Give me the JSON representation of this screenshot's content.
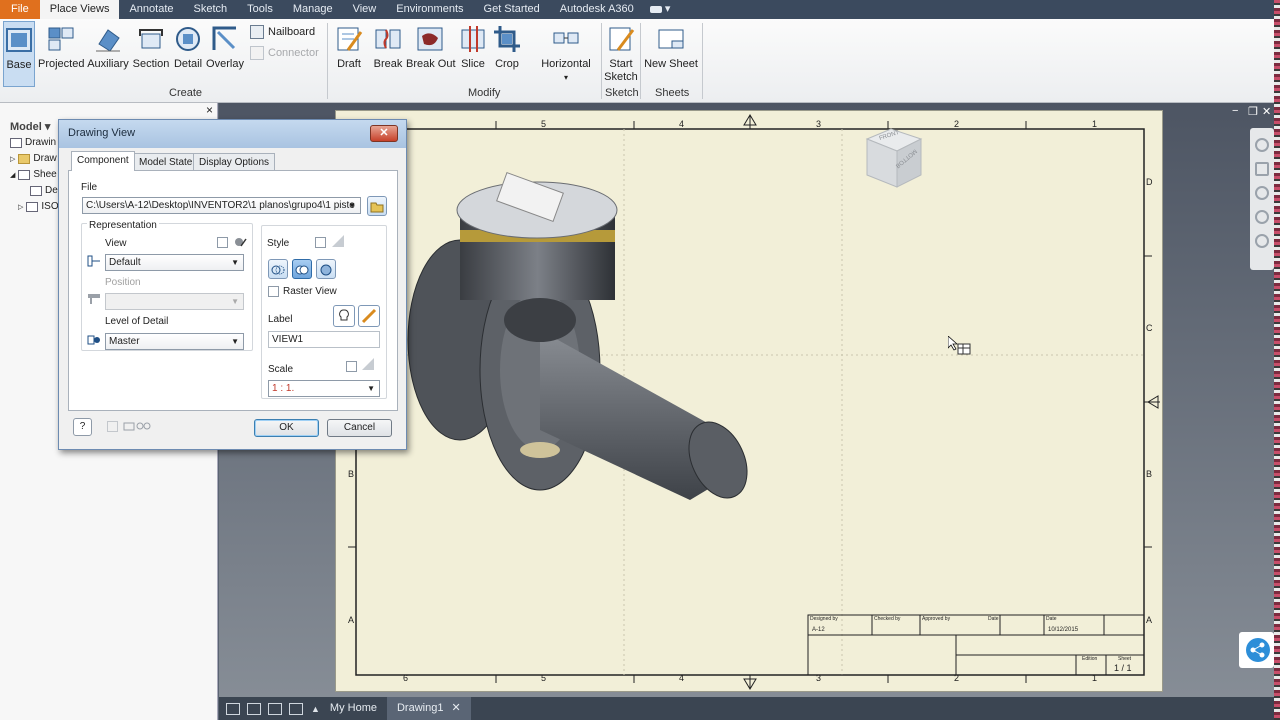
{
  "menu": {
    "items": [
      "File",
      "Place Views",
      "Annotate",
      "Sketch",
      "Tools",
      "Manage",
      "View",
      "Environments",
      "Get Started",
      "Autodesk A360"
    ],
    "active": "Place Views",
    "extra": "▾"
  },
  "ribbon": {
    "create": {
      "label": "Create",
      "buttons": [
        "Base",
        "Projected",
        "Auxiliary",
        "Section",
        "Detail",
        "Overlay"
      ],
      "small": [
        "Nailboard",
        "Connector"
      ]
    },
    "modify": {
      "label": "Modify",
      "buttons": [
        "Draft",
        "Break",
        "Break Out",
        "Slice",
        "Crop",
        "Horizontal"
      ]
    },
    "sketch": {
      "label": "Sketch",
      "button_line1": "Start",
      "button_line2": "Sketch"
    },
    "sheets": {
      "label": "Sheets",
      "button": "New Sheet"
    }
  },
  "browser": {
    "header": "Model ▾",
    "close": "×",
    "items": [
      "Drawin",
      "Draw",
      "Shee",
      "De",
      "ISO"
    ]
  },
  "dialog": {
    "title": "Drawing View",
    "close": "✕",
    "tabs": [
      "Component",
      "Model State",
      "Display Options"
    ],
    "file_label": "File",
    "file_value": "C:\\Users\\A-12\\Desktop\\INVENTOR2\\1 planos\\grupo4\\1 pisto",
    "representation_label": "Representation",
    "view_label": "View",
    "view_value": "Default",
    "position_label": "Position",
    "lod_label": "Level of Detail",
    "lod_value": "Master",
    "style_label": "Style",
    "raster_label": "Raster View",
    "label_label": "Label",
    "label_value": "VIEW1",
    "scale_label": "Scale",
    "scale_value": "1 : 1.",
    "help": "?",
    "ok": "OK",
    "cancel": "Cancel"
  },
  "sheet": {
    "col_numbers": [
      "5",
      "4",
      "3",
      "2",
      "1"
    ],
    "bottom_numbers": [
      "6",
      "5",
      "4",
      "3",
      "2",
      "1"
    ],
    "row_letters_right": [
      "D",
      "C",
      "B",
      "A"
    ],
    "row_letters_left": [
      "B",
      "A"
    ],
    "titleblock": {
      "designed_by": "Designed by",
      "checked_by": "Checked by",
      "approved_by": "Approved by",
      "date_hdr": "Date",
      "date_hdr2": "Date",
      "designer": "A-12",
      "date": "10/12/2015",
      "edition": "Edition",
      "sheet": "Sheet",
      "sheet_value": "1 / 1"
    },
    "viewcube_top": "FRONT",
    "viewcube_side": "BOTTOM"
  },
  "statusbar": {
    "tabs": [
      "My Home",
      "Drawing1"
    ],
    "close": "✕"
  },
  "colors": {
    "file_tab": "#e0701e",
    "menubar": "#3b4a5e",
    "sheet_bg": "#f2efd8"
  }
}
